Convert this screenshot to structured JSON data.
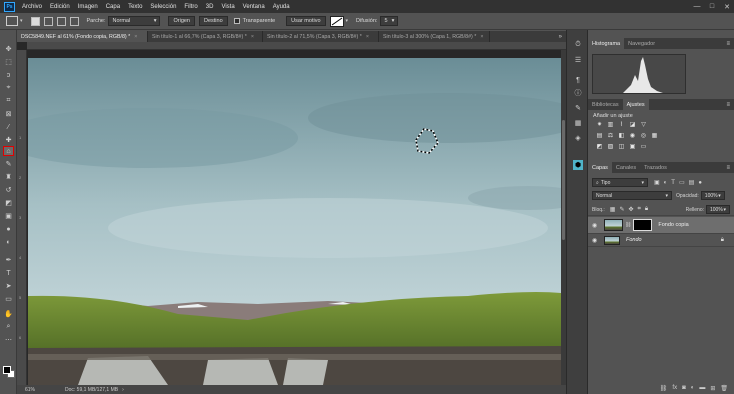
{
  "app": {
    "logo": "Ps"
  },
  "menu": [
    "Archivo",
    "Edición",
    "Imagen",
    "Capa",
    "Texto",
    "Selección",
    "Filtro",
    "3D",
    "Vista",
    "Ventana",
    "Ayuda"
  ],
  "window": {
    "minimize": "—",
    "maximize": "□",
    "close": "✕"
  },
  "options": {
    "parche_label": "Parche:",
    "parche_value": "Normal",
    "origen": "Origen",
    "destino": "Destino",
    "transparente": "Transparente",
    "usar_motivo": "Usar motivo",
    "difusion_label": "Difusión:",
    "difusion_value": "5"
  },
  "tabs": [
    {
      "label": "DSC5849.NEF al 61% (Fondo copia, RGB/8) *",
      "close": "×"
    },
    {
      "label": "Sin título-1 al 66,7% (Capa 3, RGB/8#) *",
      "close": "×"
    },
    {
      "label": "Sin título-2 al 71,5% (Capa 3, RGB/8#) *",
      "close": "×"
    },
    {
      "label": "Sin título-3 al 300% (Capa 1, RGB/8#) *",
      "close": "×"
    }
  ],
  "ruler": {
    "left_marks": [
      "1",
      "2",
      "3",
      "4",
      "5",
      "6",
      "7",
      "8"
    ]
  },
  "status": {
    "zoom": "61%",
    "doc": "Doc: 59,1 MB/127,1 MB"
  },
  "panels": {
    "top_tabs": [
      "Histograma",
      "Navegador"
    ],
    "mid_tabs": [
      "Bibliotecas",
      "Ajustes"
    ],
    "adjust_label": "Añadir un ajuste",
    "layer_tabs": [
      "Capas",
      "Canales",
      "Trazados"
    ],
    "filter_value": "Tipo",
    "blend_value": "Normal",
    "opacity_label": "Opacidad:",
    "opacity_value": "100%",
    "lock_label": "Bloq.:",
    "fill_label": "Relleno:",
    "fill_value": "100%",
    "layers": [
      {
        "name": "Fondo copia",
        "active": true
      },
      {
        "name": "Fondo",
        "active": false
      }
    ]
  },
  "icons": {
    "tools": [
      "move-icon",
      "marquee-icon",
      "lasso-icon",
      "quick-select-icon",
      "crop-icon",
      "frame-icon",
      "eyedropper-icon",
      "healing-icon",
      "patch-icon",
      "brush-icon",
      "stamp-icon",
      "history-brush-icon",
      "eraser-icon",
      "gradient-icon",
      "blur-icon",
      "dodge-icon",
      "pen-icon",
      "type-icon",
      "path-select-icon",
      "shape-icon",
      "hand-icon",
      "zoom-icon",
      "more-icon"
    ],
    "selected_tool": "patch-icon"
  },
  "colors": {
    "selected_tool_border": "#e00000",
    "accent": "#31a8ff"
  }
}
